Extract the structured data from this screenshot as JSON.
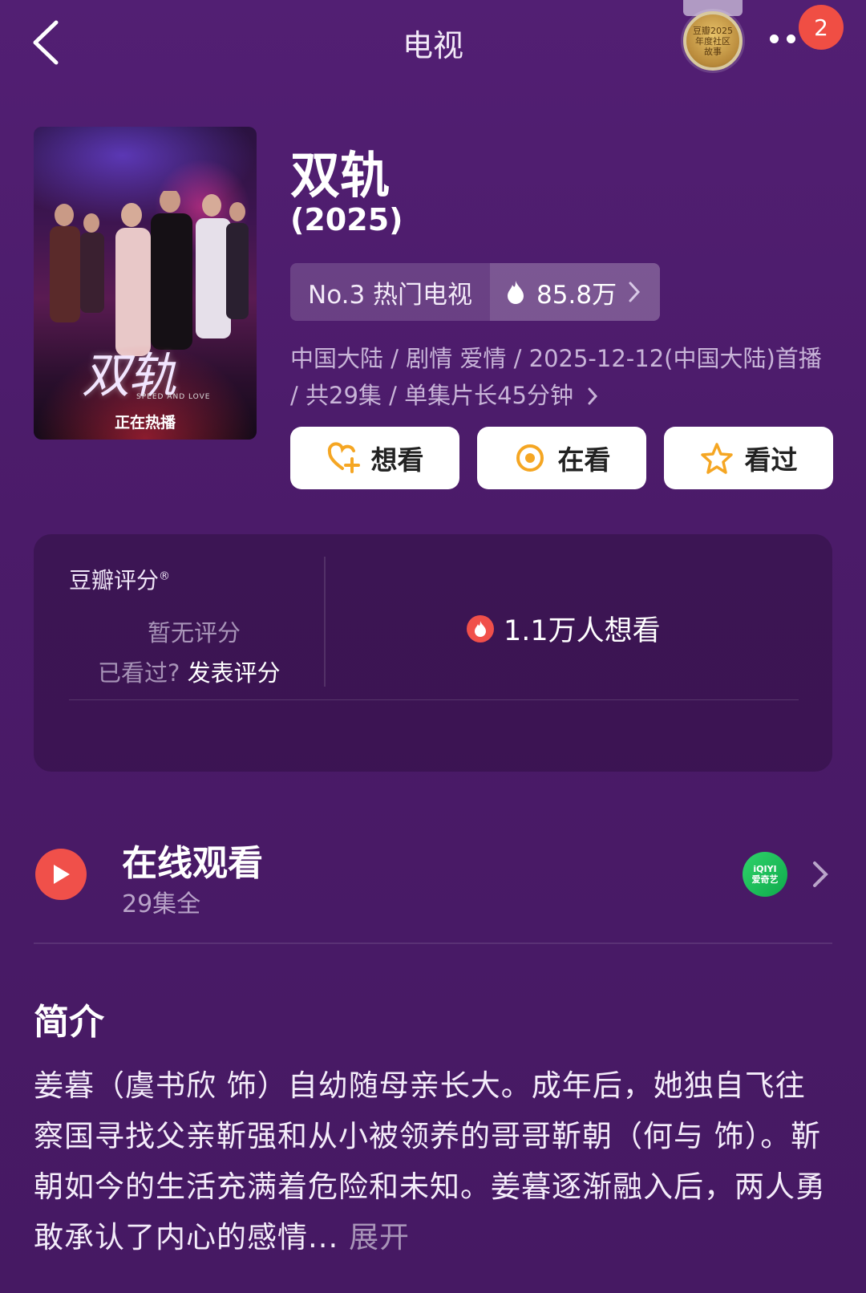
{
  "header": {
    "title": "电视",
    "notification_count": "2"
  },
  "badge": {
    "text": "豆瓣2025年度社区故事"
  },
  "poster": {
    "title_art": "双轨",
    "subtitle": "SPEED AND LOVE",
    "status": "正在热播"
  },
  "subject": {
    "title": "双轨",
    "year": "(2025)",
    "rank": "No.3 热门电视",
    "heat": "85.8万",
    "meta": "中国大陆 / 剧情 爱情 / 2025-12-12(中国大陆)首播 / 共29集 / 单集片长45分钟"
  },
  "actions": {
    "want": "想看",
    "watching": "在看",
    "watched": "看过"
  },
  "rating": {
    "label": "豆瓣评分",
    "none": "暂无评分",
    "seen_prompt": "已看过?",
    "rate_link": "发表评分",
    "want_count": "1.1万人想看"
  },
  "watch": {
    "title": "在线观看",
    "episodes": "29集全",
    "provider_top": "iQIYI",
    "provider_bottom": "爱奇艺"
  },
  "synopsis": {
    "heading": "简介",
    "text": "姜暮（虞书欣 饰）自幼随母亲长大。成年后，她独自飞往察国寻找父亲靳强和从小被领养的哥哥靳朝（何与 饰）。靳朝如今的生活充满着危险和未知。姜暮逐渐融入后，两人勇敢承认了内心的感情...",
    "expand": "展开"
  },
  "colors": {
    "background": "#4b1b69",
    "accent_red": "#f0504a",
    "star_orange": "#f5a623",
    "iqiyi_green": "#1fc25a"
  },
  "icons": {
    "back": "chevron-left-icon",
    "more": "more-icon",
    "want": "heart-plus-icon",
    "watching": "target-icon",
    "watched": "star-icon",
    "heat": "flame-icon",
    "play": "play-icon"
  }
}
